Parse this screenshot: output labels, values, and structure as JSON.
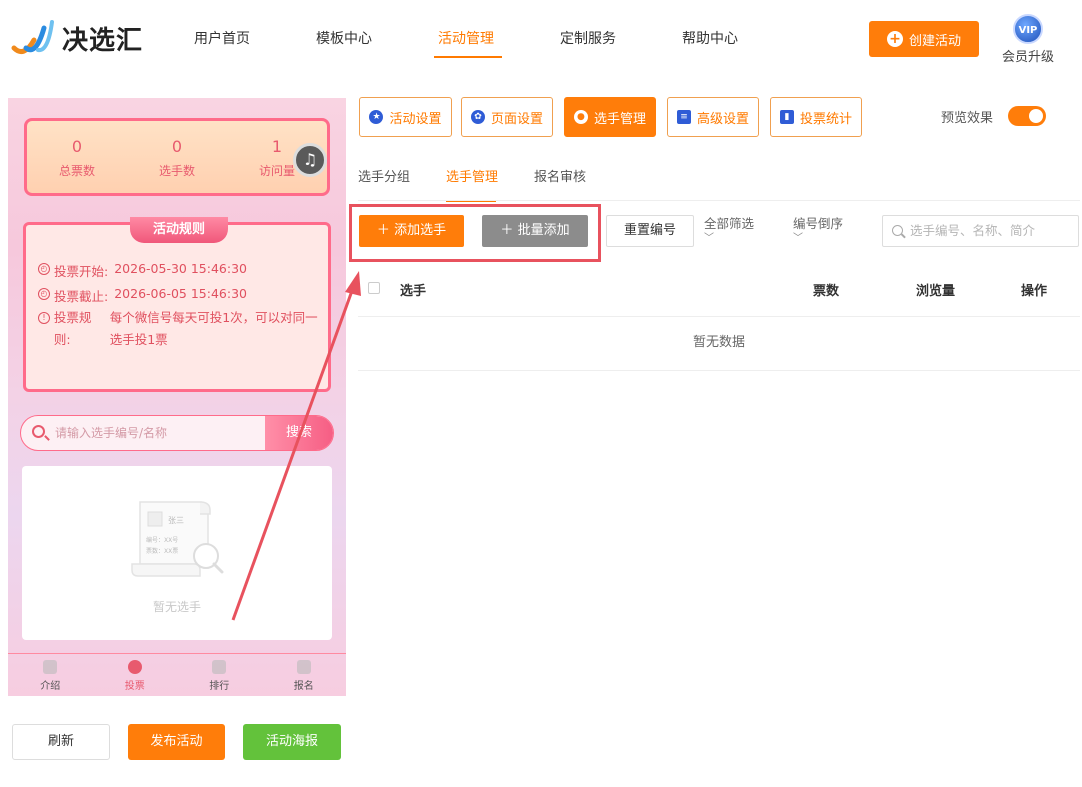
{
  "brand": {
    "name": "决选汇"
  },
  "nav": {
    "items": [
      {
        "label": "用户首页"
      },
      {
        "label": "模板中心"
      },
      {
        "label": "活动管理"
      },
      {
        "label": "定制服务"
      },
      {
        "label": "帮助中心"
      }
    ],
    "create_label": "创建活动",
    "vip_badge": "VIP",
    "vip_label": "会员升级"
  },
  "preview": {
    "stats": [
      {
        "value": "0",
        "label": "总票数"
      },
      {
        "value": "0",
        "label": "选手数"
      },
      {
        "value": "1",
        "label": "访问量"
      }
    ],
    "rules_title": "活动规则",
    "rules": [
      {
        "label": "投票开始:",
        "value": "2026-05-30 15:46:30"
      },
      {
        "label": "投票截止:",
        "value": "2026-06-05 15:46:30"
      },
      {
        "label": "投票规则:",
        "value": "每个微信号每天可投1次，可以对同一选手投1票"
      }
    ],
    "search_placeholder": "请输入选手编号/名称",
    "search_button": "搜索",
    "empty_text": "暂无选手",
    "empty_card_name": "张三",
    "empty_card_line1": "编号：XX号",
    "empty_card_line2": "票数：XX票",
    "tabs": [
      {
        "label": "介绍"
      },
      {
        "label": "投票"
      },
      {
        "label": "排行"
      },
      {
        "label": "报名"
      }
    ]
  },
  "bottom_buttons": {
    "refresh": "刷新",
    "publish": "发布活动",
    "poster": "活动海报"
  },
  "toolbar": {
    "buttons": [
      {
        "label": "活动设置",
        "icon": "star-icon"
      },
      {
        "label": "页面设置",
        "icon": "gear-icon"
      },
      {
        "label": "选手管理",
        "icon": "users-icon"
      },
      {
        "label": "高级设置",
        "icon": "settings-list-icon"
      },
      {
        "label": "投票统计",
        "icon": "bar-chart-icon"
      }
    ],
    "preview_label": "预览效果"
  },
  "subtabs": [
    {
      "label": "选手分组"
    },
    {
      "label": "选手管理"
    },
    {
      "label": "报名审核"
    }
  ],
  "actions": {
    "add": "添加选手",
    "batch": "批量添加",
    "reset": "重置编号",
    "filter_all": "全部筛选",
    "filter_order": "编号倒序",
    "search_placeholder": "选手编号、名称、简介"
  },
  "table": {
    "columns": [
      "选手",
      "票数",
      "浏览量",
      "操作"
    ],
    "empty": "暂无数据"
  },
  "colors": {
    "accent": "#ff7d0a",
    "pink": "#ff6b8a",
    "green": "#63c23b",
    "highlight": "#e8525e"
  }
}
